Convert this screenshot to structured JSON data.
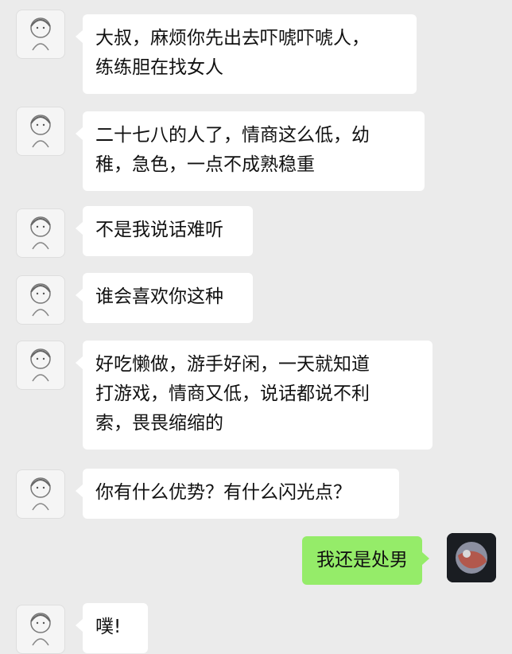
{
  "messages": [
    {
      "side": "left",
      "lines": [
        "大叔，麻烦你先出去吓唬吓唬人，",
        "练练胆在找女人"
      ]
    },
    {
      "side": "left",
      "lines": [
        "二十七八的人了，情商这么低，幼",
        "稚，急色，一点不成熟稳重"
      ]
    },
    {
      "side": "left",
      "lines": [
        "不是我说话难听"
      ]
    },
    {
      "side": "left",
      "lines": [
        "谁会喜欢你这种"
      ]
    },
    {
      "side": "left",
      "lines": [
        "好吃懒做，游手好闲，一天就知道",
        "打游戏，情商又低，说话都说不利",
        "索，畏畏缩缩的"
      ]
    },
    {
      "side": "left",
      "lines": [
        "你有什么优势？有什么闪光点？"
      ]
    },
    {
      "side": "right",
      "lines": [
        "我还是处男"
      ]
    },
    {
      "side": "left",
      "lines": [
        "噗!"
      ]
    }
  ],
  "colors": {
    "background": "#ebebeb",
    "left_bubble": "#ffffff",
    "right_bubble": "#95ec69"
  },
  "icons": {
    "left_avatar": "sketch-girl-avatar-icon",
    "right_avatar": "planet-avatar-icon"
  }
}
